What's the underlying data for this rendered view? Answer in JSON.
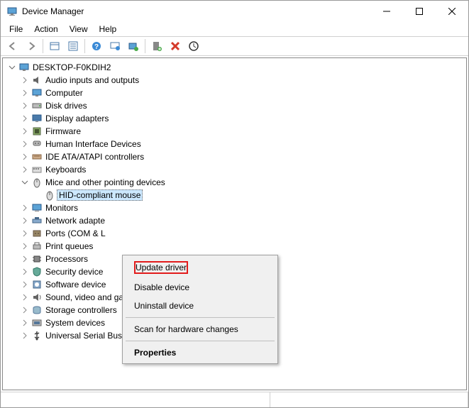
{
  "window": {
    "title": "Device Manager"
  },
  "menubar": {
    "items": [
      "File",
      "Action",
      "View",
      "Help"
    ]
  },
  "toolbar": {
    "icons": [
      "back",
      "forward",
      "sep",
      "show-hidden",
      "properties",
      "sep",
      "help",
      "action-center",
      "update",
      "sep",
      "add-hardware",
      "remove",
      "scan"
    ]
  },
  "tree": {
    "root": "DESKTOP-F0KDIH2",
    "nodes": [
      {
        "label": "Audio inputs and outputs",
        "icon": "audio-icon"
      },
      {
        "label": "Computer",
        "icon": "computer-icon"
      },
      {
        "label": "Disk drives",
        "icon": "disk-icon"
      },
      {
        "label": "Display adapters",
        "icon": "display-icon"
      },
      {
        "label": "Firmware",
        "icon": "firmware-icon"
      },
      {
        "label": "Human Interface Devices",
        "icon": "hid-icon"
      },
      {
        "label": "IDE ATA/ATAPI controllers",
        "icon": "ide-icon"
      },
      {
        "label": "Keyboards",
        "icon": "keyboard-icon"
      },
      {
        "label": "Mice and other pointing devices",
        "icon": "mouse-icon",
        "expanded": true,
        "children": [
          {
            "label": "HID-compliant mouse",
            "icon": "mouse-icon",
            "selected": true
          }
        ]
      },
      {
        "label": "Monitors",
        "icon": "monitor-icon"
      },
      {
        "label": "Network adapters",
        "icon": "network-icon"
      },
      {
        "label": "Ports (COM & LPT)",
        "icon": "ports-icon"
      },
      {
        "label": "Print queues",
        "icon": "printer-icon"
      },
      {
        "label": "Processors",
        "icon": "cpu-icon"
      },
      {
        "label": "Security devices",
        "icon": "security-icon"
      },
      {
        "label": "Software devices",
        "icon": "software-icon"
      },
      {
        "label": "Sound, video and game controllers",
        "icon": "sound-icon"
      },
      {
        "label": "Storage controllers",
        "icon": "storage-icon"
      },
      {
        "label": "System devices",
        "icon": "system-icon"
      },
      {
        "label": "Universal Serial Bus controllers",
        "icon": "usb-icon"
      }
    ],
    "truncated": {
      "9": "Monitors",
      "10": "Network adapte",
      "11": "Ports (COM & L",
      "12": "Print queues",
      "13": "Processors",
      "14": "Security device",
      "15": "Software device"
    }
  },
  "contextMenu": {
    "items": [
      {
        "label": "Update driver",
        "highlighted": true
      },
      {
        "label": "Disable device"
      },
      {
        "label": "Uninstall device"
      },
      {
        "sep": true
      },
      {
        "label": "Scan for hardware changes"
      },
      {
        "sep": true
      },
      {
        "label": "Properties",
        "bold": true
      }
    ]
  }
}
